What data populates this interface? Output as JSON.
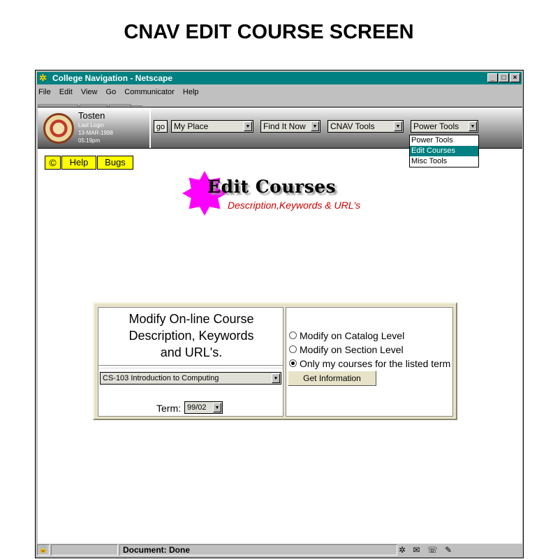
{
  "caption": "CNAV EDIT COURSE SCREEN",
  "window": {
    "title": "College Navigation - Netscape",
    "controls": [
      "_",
      "□",
      "×"
    ]
  },
  "menu": [
    "File",
    "Edit",
    "View",
    "Go",
    "Communicator",
    "Help"
  ],
  "user": {
    "name": "Tosten",
    "last_login_label": "Last Login",
    "date": "13-MAR-1998",
    "time": "05:19pm"
  },
  "nav": {
    "go_label": "go",
    "selects": [
      {
        "value": "My Place"
      },
      {
        "value": "Find It Now"
      },
      {
        "value": "CNAV Tools"
      },
      {
        "value": "Power Tools"
      }
    ],
    "dropdown_open": [
      "Power Tools",
      "Edit Courses",
      "Misc Tools"
    ],
    "dropdown_highlighted": "Edit Courses"
  },
  "buttons": {
    "copyright": "©",
    "help": "Help",
    "bugs": "Bugs"
  },
  "logo": {
    "title": "Edit Courses",
    "subtitle": "Description,Keywords & URL's"
  },
  "form": {
    "heading_line1": "Modify On-line Course",
    "heading_line2": "Description, Keywords",
    "heading_line3": "and URL's.",
    "course_select": "CS-103 Introduction to Computing",
    "term_label": "Term:",
    "term_value": "99/02",
    "radios": [
      {
        "label": "Modify on Catalog Level",
        "checked": false
      },
      {
        "label": "Modify on Section Level",
        "checked": false
      },
      {
        "label": "Only my courses for the listed term",
        "checked": true
      }
    ],
    "submit": "Get Information"
  },
  "status": {
    "text": "Document: Done"
  },
  "colors": {
    "titlebar": "#008080",
    "button_yellow": "#ffff00",
    "logo_magenta": "#ff00ff",
    "subtitle_red": "#d00000"
  }
}
